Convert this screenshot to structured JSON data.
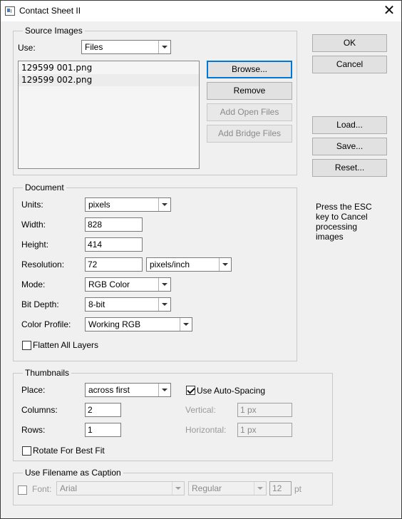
{
  "window": {
    "title": "Contact Sheet II",
    "icon": "app-icon",
    "close_icon": "close-icon"
  },
  "source_images": {
    "legend": "Source Images",
    "use_label": "Use:",
    "use_value": "Files",
    "files": [
      "129599 001.png",
      "129599 002.png"
    ],
    "browse_label": "Browse...",
    "remove_label": "Remove",
    "add_open_label": "Add Open Files",
    "add_bridge_label": "Add Bridge Files"
  },
  "document": {
    "legend": "Document",
    "units_label": "Units:",
    "units_value": "pixels",
    "width_label": "Width:",
    "width_value": "828",
    "height_label": "Height:",
    "height_value": "414",
    "resolution_label": "Resolution:",
    "resolution_value": "72",
    "resolution_unit": "pixels/inch",
    "mode_label": "Mode:",
    "mode_value": "RGB Color",
    "bitdepth_label": "Bit Depth:",
    "bitdepth_value": "8-bit",
    "profile_label": "Color Profile:",
    "profile_value": "Working RGB",
    "flatten_label": "Flatten All Layers",
    "flatten_checked": false
  },
  "thumbnails": {
    "legend": "Thumbnails",
    "place_label": "Place:",
    "place_value": "across first",
    "autospacing_label": "Use Auto-Spacing",
    "autospacing_checked": true,
    "columns_label": "Columns:",
    "columns_value": "2",
    "rows_label": "Rows:",
    "rows_value": "1",
    "vertical_label": "Vertical:",
    "vertical_value": "1 px",
    "horizontal_label": "Horizontal:",
    "horizontal_value": "1 px",
    "rotate_label": "Rotate For Best Fit",
    "rotate_checked": false
  },
  "caption": {
    "legend": "Use Filename as Caption",
    "checked": false,
    "font_label": "Font:",
    "font_value": "Arial",
    "style_value": "Regular",
    "size_value": "12",
    "size_unit": "pt"
  },
  "buttons": {
    "ok": "OK",
    "cancel": "Cancel",
    "load": "Load...",
    "save": "Save...",
    "reset": "Reset..."
  },
  "note": "Press the ESC key to Cancel processing images"
}
